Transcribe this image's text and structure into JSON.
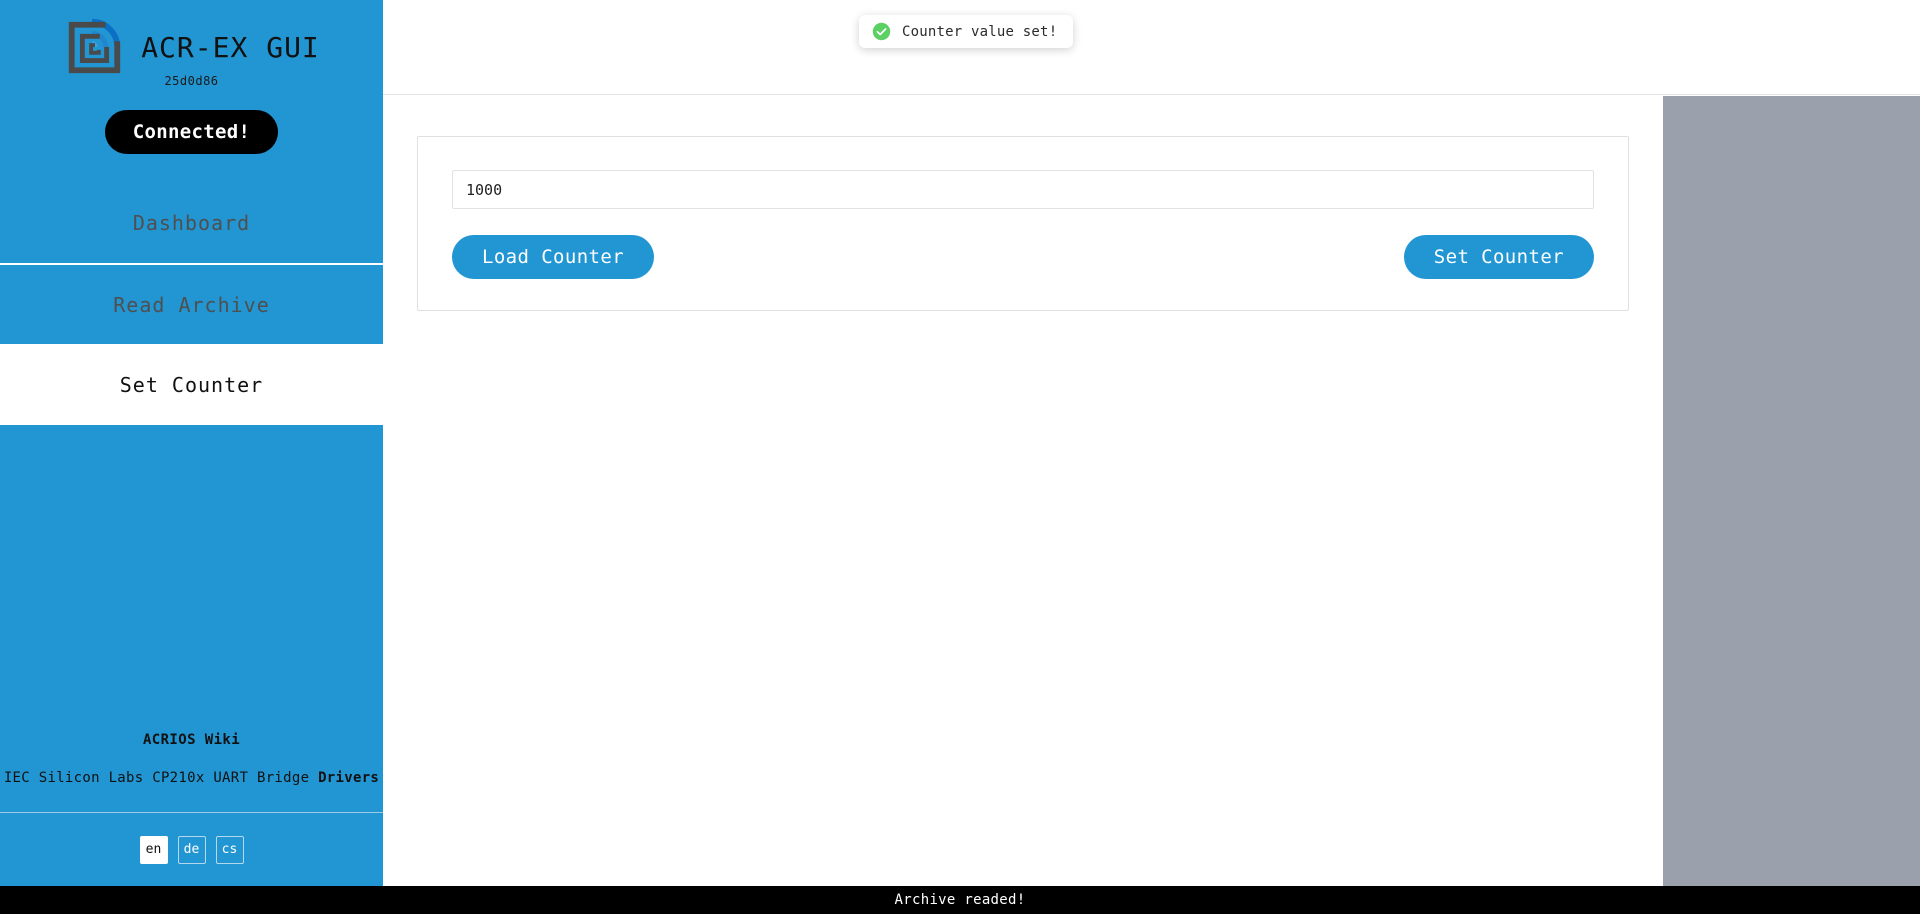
{
  "app": {
    "title": "ACR-EX GUI",
    "version": "25d0d86",
    "logo_icon": "acrios-nested-square-wifi-logo",
    "accent_color": "#2196d3",
    "sidebar_bg": "#2196d3",
    "gray_panel_color": "#9aa1ad"
  },
  "sidebar": {
    "connection": {
      "label": "Connected!",
      "bg_color": "#000000",
      "text_color": "#ffffff"
    },
    "nav_items": [
      {
        "label": "Dashboard",
        "active": false
      },
      {
        "label": "Read Archive",
        "active": false
      },
      {
        "label": "Set Counter",
        "active": true
      }
    ],
    "links": {
      "wiki": "ACRIOS Wiki",
      "drivers_prefix": "IEC Silicon Labs CP210x UART Bridge ",
      "drivers_link": "Drivers"
    },
    "languages": [
      {
        "code": "en",
        "active": true
      },
      {
        "code": "de",
        "active": false
      },
      {
        "code": "cs",
        "active": false
      }
    ]
  },
  "header": {
    "toast": {
      "message": "Counter value set!",
      "icon": "check-circle-icon",
      "icon_color": "#5bd063"
    }
  },
  "main": {
    "counter_input": {
      "value": "1000",
      "placeholder": ""
    },
    "load_button": "Load Counter",
    "set_button": "Set Counter"
  },
  "statusbar": {
    "message": "Archive readed!"
  }
}
